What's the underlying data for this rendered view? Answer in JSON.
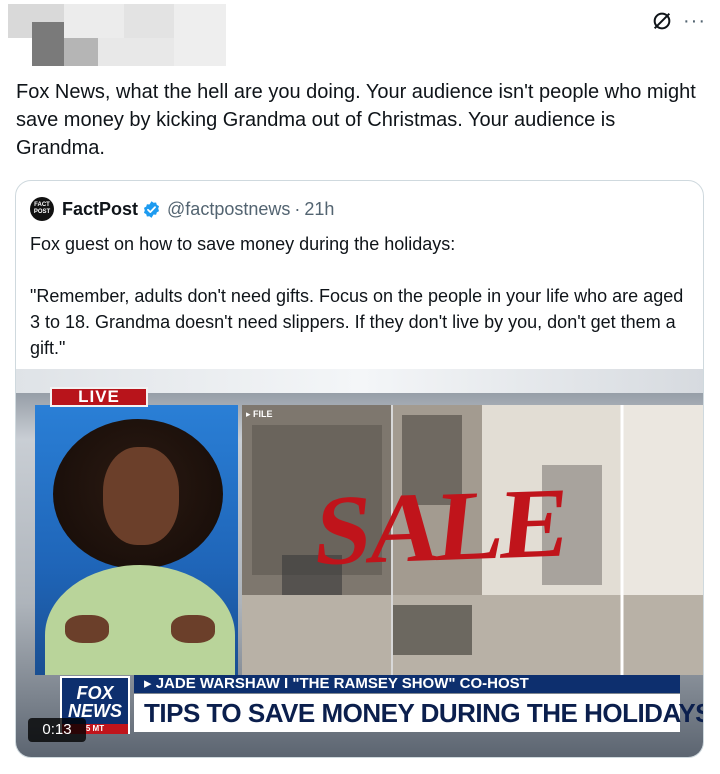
{
  "header": {
    "author_redacted": true,
    "more_label": "···"
  },
  "tweet": {
    "text": "Fox News, what the hell are you doing. Your audience isn't people who might save money by kicking Grandma out of Christmas. Your audience is Grandma."
  },
  "quote": {
    "avatar_text": "FACT POST",
    "name": "FactPost",
    "handle": "@factpostnews",
    "separator": "·",
    "time": "21h",
    "text": "Fox guest on how to save money during the holidays:\n\n\"Remember, adults don't need gifts. Focus on the people in your life who are aged 3 to 18. Grandma doesn't need slippers. If they don't live by you, don't get them a gift.\""
  },
  "video": {
    "live_badge": "LIVE",
    "file_tag": "▸ FILE",
    "sale_sign": "SALE",
    "logo_top": "FOX",
    "logo_bottom": "NEWS",
    "logo_tag": "5 MT",
    "subhead": "▸ JADE WARSHAW I \"THE RAMSEY SHOW\" CO-HOST",
    "headline": "TIPS TO SAVE MONEY DURING THE HOLIDAYS",
    "timestamp": "0:13"
  },
  "colors": {
    "verified": "#1d9bf0",
    "live_red": "#b8141b",
    "fox_navy": "#0d2f6e"
  },
  "icons": [
    "slash-circle-icon",
    "more-icon",
    "verified-badge-icon"
  ]
}
